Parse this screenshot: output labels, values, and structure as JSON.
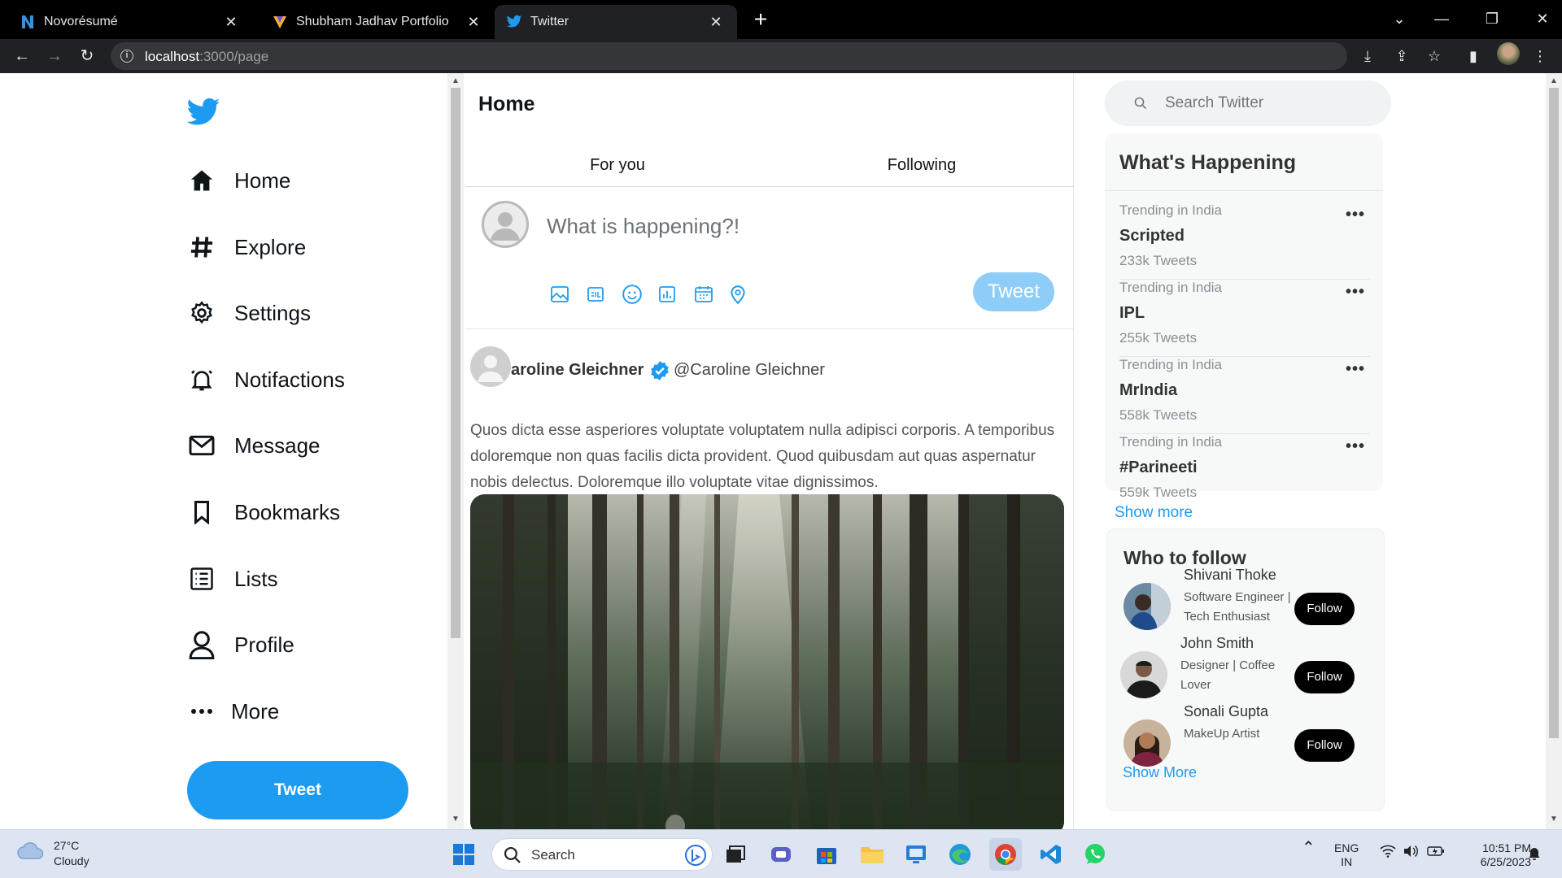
{
  "browser": {
    "tabs": [
      {
        "title": "Novorésumé",
        "icon": "novoresume-icon"
      },
      {
        "title": "Shubham Jadhav Portfolio",
        "icon": "portfolio-icon"
      },
      {
        "title": "Twitter",
        "icon": "twitter-icon",
        "active": true
      }
    ],
    "url_host": "localhost",
    "url_path": ":3000/page"
  },
  "sidebar": {
    "items": [
      {
        "label": "Home",
        "icon": "home-icon"
      },
      {
        "label": "Explore",
        "icon": "hashtag-icon"
      },
      {
        "label": "Settings",
        "icon": "gear-icon"
      },
      {
        "label": "Notifactions",
        "icon": "bell-icon"
      },
      {
        "label": "Message",
        "icon": "mail-icon"
      },
      {
        "label": "Bookmarks",
        "icon": "bookmark-icon"
      },
      {
        "label": "Lists",
        "icon": "list-icon"
      },
      {
        "label": "Profile",
        "icon": "user-icon"
      },
      {
        "label": "More",
        "icon": "more-icon"
      }
    ],
    "tweet_button": "Tweet"
  },
  "main": {
    "title": "Home",
    "tabs": [
      "For you",
      "Following"
    ],
    "composer": {
      "placeholder": "What is happening?!",
      "tweet_button": "Tweet",
      "tools": [
        "image-icon",
        "gif-icon",
        "emoji-icon",
        "poll-icon",
        "schedule-icon",
        "location-icon"
      ]
    },
    "post": {
      "name": "aroline Gleichner",
      "handle": "@Caroline Gleichner",
      "text": "Quos dicta esse asperiores voluptate voluptatem nulla adipisci corporis. A temporibus doloremque non quas facilis dicta provident. Quod quibusdam aut quas aspernatur nobis delectus. Doloremque illo voluptate vitae dignissimos."
    }
  },
  "right": {
    "search_placeholder": "Search Twitter",
    "happening": {
      "title": "What's Happening",
      "trends": [
        {
          "category": "Trending in India",
          "name": "Scripted",
          "count": "233k Tweets"
        },
        {
          "category": "Trending in India",
          "name": "IPL",
          "count": "255k Tweets"
        },
        {
          "category": "Trending in India",
          "name": "MrIndia",
          "count": "558k Tweets"
        },
        {
          "category": "Trending in India",
          "name": "#Parineeti",
          "count": "559k Tweets"
        }
      ],
      "show_more": "Show more"
    },
    "who_to_follow": {
      "title": "Who to follow",
      "people": [
        {
          "name": "Shivani Thoke",
          "bio": "Software Engineer | Tech Enthusiast",
          "button": "Follow"
        },
        {
          "name": "John Smith",
          "bio": "Designer | Coffee Lover",
          "button": "Follow"
        },
        {
          "name": "Sonali Gupta",
          "bio": "MakeUp Artist",
          "button": "Follow"
        }
      ],
      "show_more": "Show More"
    }
  },
  "taskbar": {
    "temp": "27°C",
    "weather": "Cloudy",
    "search": "Search",
    "lang1": "ENG",
    "lang2": "IN",
    "time": "10:51 PM",
    "date": "6/25/2023"
  },
  "colors": {
    "accent": "#1d9bf0",
    "tweet_disabled": "#8ecdf8",
    "follow_button": "#000000"
  }
}
